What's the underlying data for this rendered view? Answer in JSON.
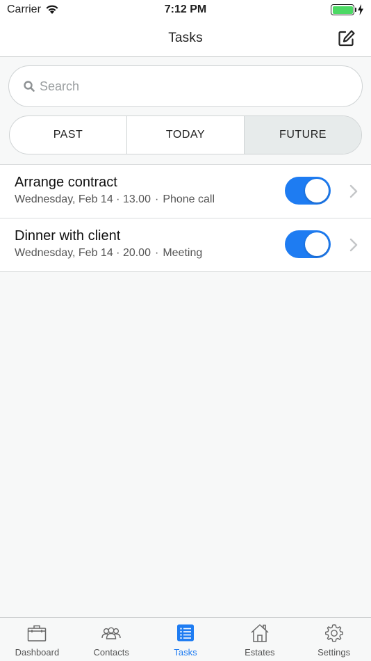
{
  "status": {
    "carrier": "Carrier",
    "time": "7:12 PM"
  },
  "nav": {
    "title": "Tasks",
    "compose_icon": "compose-icon"
  },
  "search": {
    "placeholder": "Search",
    "value": ""
  },
  "segments": [
    {
      "label": "PAST",
      "active": false
    },
    {
      "label": "TODAY",
      "active": false
    },
    {
      "label": "FUTURE",
      "active": true
    }
  ],
  "tasks": [
    {
      "title": "Arrange contract",
      "date": "Wednesday, Feb 14 · 13.00",
      "sep": "·",
      "type": "Phone call",
      "enabled": true
    },
    {
      "title": "Dinner with client",
      "date": "Wednesday, Feb 14 · 20.00",
      "sep": "·",
      "type": "Meeting",
      "enabled": true
    }
  ],
  "tabs": [
    {
      "label": "Dashboard",
      "icon": "briefcase-icon",
      "active": false
    },
    {
      "label": "Contacts",
      "icon": "people-icon",
      "active": false
    },
    {
      "label": "Tasks",
      "icon": "list-icon",
      "active": true
    },
    {
      "label": "Estates",
      "icon": "house-icon",
      "active": false
    },
    {
      "label": "Settings",
      "icon": "gear-icon",
      "active": false
    }
  ],
  "colors": {
    "accent": "#1e7cf2",
    "battery": "#4cd964",
    "segment_active": "#e7ebeb"
  }
}
